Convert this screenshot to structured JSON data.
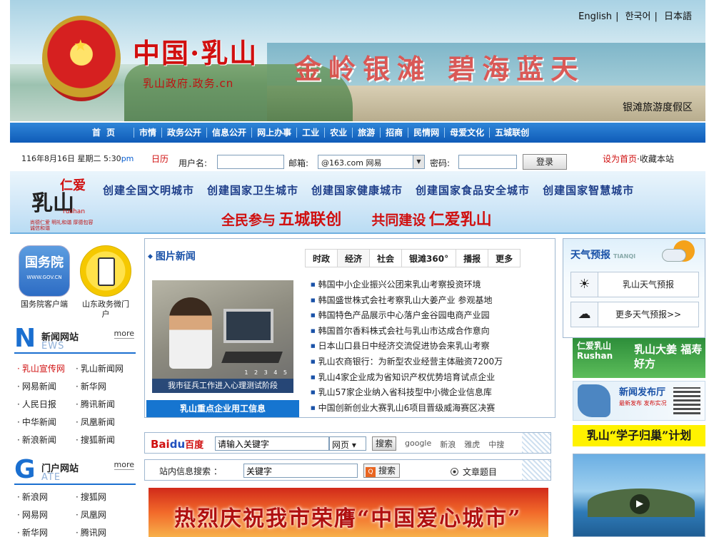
{
  "header": {
    "title": "中国·乳山",
    "domain": "乳山政府.政务.cn",
    "slogan": "金岭银滩  碧海蓝天",
    "caption": "银滩旅游度假区",
    "languages": [
      "English",
      "한국어",
      "日本語"
    ]
  },
  "nav": {
    "items": [
      "首页",
      "市情",
      "政务公开",
      "信息公开",
      "网上办事",
      "工业",
      "农业",
      "旅游",
      "招商",
      "民情网",
      "母爱文化",
      "五城联创"
    ]
  },
  "login": {
    "date": "116年8月16日 星期二 5:30",
    "ampm": "pm",
    "calendar": "日历",
    "username_label": "用户名:",
    "email_label": "邮箱:",
    "email_domain": "@163.com 网易",
    "password_label": "密码:",
    "login_button": "登录",
    "set_home": "设为首页",
    "favorite": "·收藏本站"
  },
  "campaign": {
    "logo_main": "乳山",
    "logo_red": "仁爱",
    "logo_en": "rushan",
    "logo_motto": "尚德仁爱 明礼和谐 厚德包容 诚信和谐",
    "goals": [
      "创建全国文明城市",
      "创建国家卫生城市",
      "创建国家健康城市",
      "创建国家食品安全城市",
      "创建国家智慧城市"
    ],
    "motto_1": "全民参与",
    "motto_2": "五城联创",
    "motto_3": "共同建设",
    "motto_4": "仁爱乳山"
  },
  "apps": {
    "gwy_icon_text": "国务院",
    "gwy_icon_sub": "WWW.GOV.CN",
    "gwy_label": "国务院客户端",
    "sd_label": "山东政务微门户"
  },
  "news_sites": {
    "letter": "N",
    "title": "新闻网站",
    "en": "EWS",
    "more": "more",
    "links": [
      "乳山宣传网",
      "乳山新闻网",
      "网易新闻",
      "新华网",
      "人民日报",
      "腾讯新闻",
      "中华新闻",
      "凤凰新闻",
      "新浪新闻",
      "搜狐新闻"
    ]
  },
  "portal_sites": {
    "letter": "G",
    "title": "门户网站",
    "en": "ATE",
    "more": "more",
    "links": [
      "新浪网",
      "搜狐网",
      "网易网",
      "凤凰网",
      "新华网",
      "腾讯网"
    ]
  },
  "picture_news": {
    "heading": "图片新闻",
    "caption": "我市征兵工作进入心理测试阶段",
    "pager": "1 2 3 4 5",
    "job_bar": "乳山重点企业用工信息"
  },
  "tabs": [
    "时政",
    "经济",
    "社会",
    "银滩360°",
    "播报",
    "更多"
  ],
  "news": [
    "韩国中小企业振兴公团来乳山考察投资环境",
    "韩国盛世株式会社考察乳山大姜产业 参观基地",
    "韩国特色产品展示中心落户金谷园电商产业园",
    "韩国首尔香料株式会社与乳山市达成合作意向",
    "日本山口县日中经济交流促进协会来乳山考察",
    "乳山农商银行：为新型农业经营主体融资7200万",
    "乳山4家企业成为省知识产权优势培育试点企业",
    "乳山57家企业纳入省科技型中小微企业信息库",
    "中国创新创业大赛乳山6项目晋级威海赛区决赛"
  ],
  "baidu": {
    "logo": "Bai",
    "logo_b": "du",
    "logo_cn": "百度",
    "placeholder": "请输入关键字",
    "type": "网页",
    "button": "搜索",
    "engines": [
      "google",
      "新浪",
      "雅虎",
      "中搜"
    ]
  },
  "site_search": {
    "label": "站内信息搜索 ：",
    "value": "关键字",
    "button": "搜索",
    "radio_label": "文章题目"
  },
  "promo": {
    "text": "热烈庆祝我市荣膺“中国爱心城市”"
  },
  "weather": {
    "heading": "天气预报",
    "heading_en": "TIANQI",
    "btn1": "乳山天气预报",
    "btn2": "更多天气预报>>"
  },
  "ads": {
    "ad1_left": "仁爱乳山",
    "ad1_left_en": "Rushan",
    "ad1_right": "乳山大姜 福寿好方",
    "ad2_title": "新闻发布厅",
    "ad2_sub": "最新发布 发布实况",
    "ad3": "乳山“学子归巢”计划"
  },
  "colors": {
    "nav_bg": "#0f5bb8",
    "accent_red": "#d01010",
    "link_blue": "#1a52a8"
  }
}
